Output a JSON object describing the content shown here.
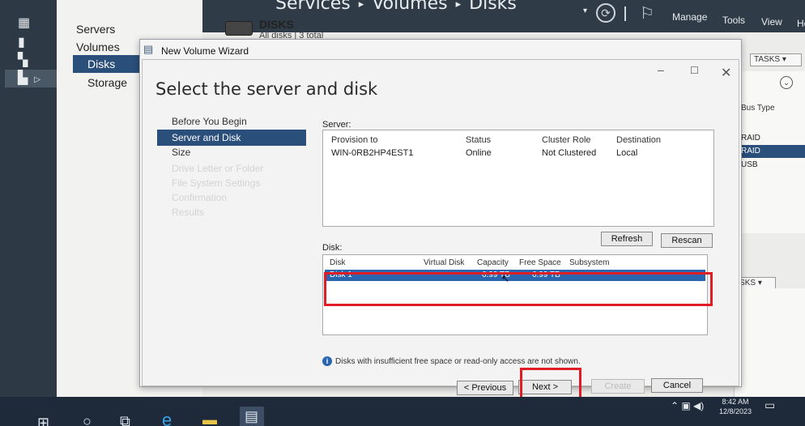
{
  "server_manager": {
    "breadcrumb": [
      "Services",
      "Volumes",
      "Disks"
    ],
    "breadcrumb_sep": "▸",
    "menu": {
      "manage": "Manage",
      "tools": "Tools",
      "view": "View",
      "help": "He"
    },
    "nav": {
      "servers": "Servers",
      "volumes": "Volumes",
      "disks": "Disks",
      "storage": "Storage"
    },
    "disks_title": "DISKS",
    "disks_subtitle": "All disks | 3 total",
    "tasks_label": "TASKS",
    "bus_type_header": "Bus Type",
    "bus_rows": [
      "RAID",
      "RAID",
      "USB"
    ]
  },
  "wizard": {
    "title": "New Volume Wizard",
    "heading": "Select the server and disk",
    "steps": [
      {
        "label": "Before You Begin",
        "state": "normal"
      },
      {
        "label": "Server and Disk",
        "state": "active"
      },
      {
        "label": "Size",
        "state": "normal"
      },
      {
        "label": "Drive Letter or Folder",
        "state": "disabled"
      },
      {
        "label": "File System Settings",
        "state": "disabled"
      },
      {
        "label": "Confirmation",
        "state": "disabled"
      },
      {
        "label": "Results",
        "state": "disabled"
      }
    ],
    "server_label": "Server:",
    "server_columns": [
      "Provision to",
      "Status",
      "Cluster Role",
      "Destination"
    ],
    "server_row": {
      "name": "WIN-0RB2HP4EST1",
      "status": "Online",
      "cluster_role": "Not Clustered",
      "destination": "Local"
    },
    "refresh_label": "Refresh",
    "rescan_label": "Rescan",
    "disk_label": "Disk:",
    "disk_columns": [
      "Disk",
      "Virtual Disk",
      "Capacity",
      "Free Space",
      "Subsystem"
    ],
    "disk_row": {
      "disk": "Disk 1",
      "virtual_disk": "",
      "capacity": "6.99 TB",
      "free_space": "6.99 TB",
      "subsystem": ""
    },
    "info_text": "Disks with insufficient free space or read-only access are not shown.",
    "buttons": {
      "previous": "< Previous",
      "next": "Next >",
      "create": "Create",
      "cancel": "Cancel"
    }
  },
  "taskbar": {
    "time": "8:42 AM",
    "date": "12/8/2023"
  },
  "colors": {
    "selection_blue": "#2a4f7a",
    "row_highlight": "#2a66b0",
    "annotation_red": "#e01c24"
  }
}
